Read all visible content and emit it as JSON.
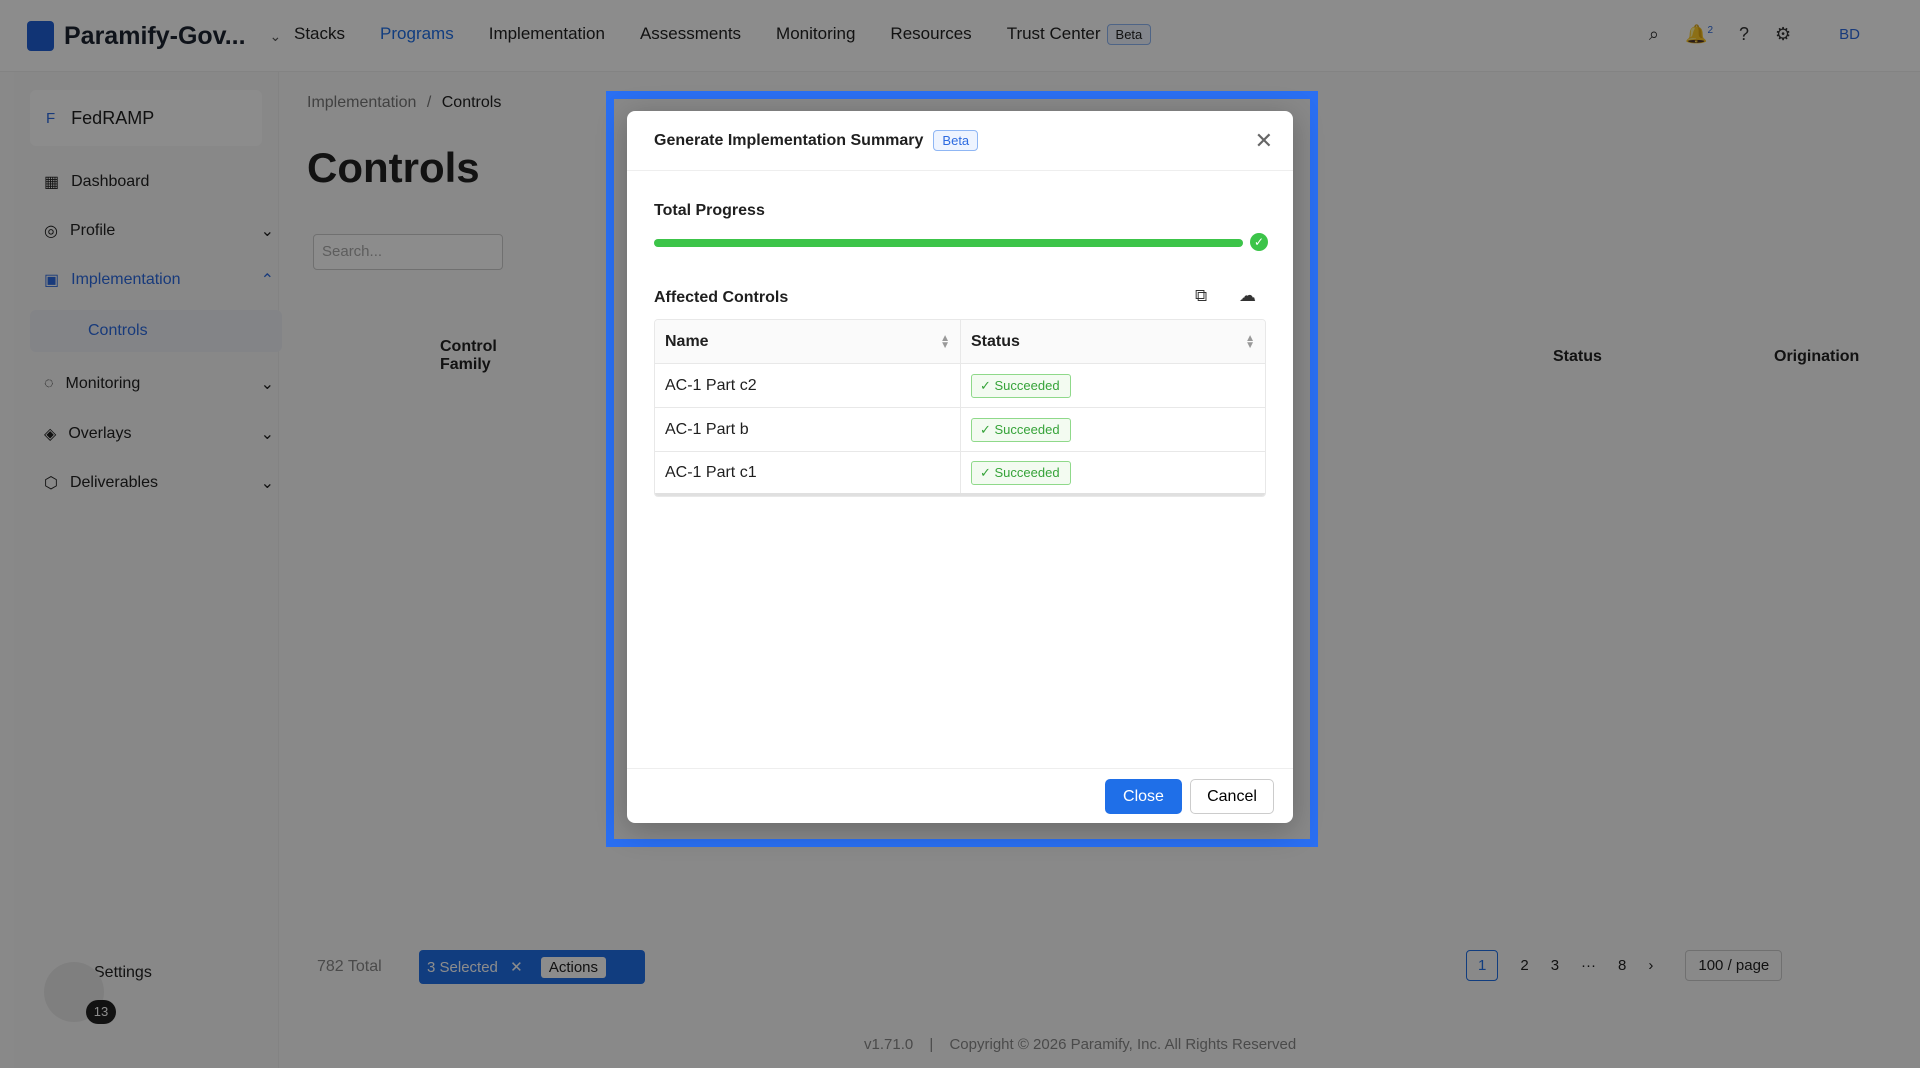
{
  "topbar": {
    "brand": "Paramify-Gov...",
    "nav": [
      {
        "label": "Stacks"
      },
      {
        "label": "Programs"
      },
      {
        "label": "Implementation"
      },
      {
        "label": "Assessments"
      },
      {
        "label": "Monitoring"
      },
      {
        "label": "Resources"
      },
      {
        "label": "Trust Center"
      }
    ],
    "beta": "Beta",
    "notif_count": "2",
    "avatar": "BD"
  },
  "sidebar": {
    "org": "FedRAMP",
    "org_initial": "F",
    "items": [
      {
        "label": "Dashboard"
      },
      {
        "label": "Profile"
      },
      {
        "label": "Implementation"
      },
      {
        "label": "Monitoring"
      },
      {
        "label": "Overlays"
      },
      {
        "label": "Deliverables"
      }
    ],
    "sub": "Controls",
    "settings": "Settings",
    "help_badge": "13"
  },
  "page": {
    "breadcrumb_parent": "Implementation",
    "breadcrumb_sep": "/",
    "breadcrumb_current": "Controls",
    "title": "Controls",
    "search_placeholder": "Search...",
    "total": "782 Total",
    "selected": "3 Selected",
    "actions": "Actions",
    "pages": [
      "1",
      "2",
      "3",
      "8"
    ],
    "per_page": "100 / page",
    "version": "v1.71.0",
    "copyright": "Copyright © 2026 Paramify, Inc. All Rights Reserved",
    "col_family": "Control Family",
    "col_status": "Status",
    "col_origination": "Origination"
  },
  "modal": {
    "title": "Generate Implementation Summary",
    "beta": "Beta",
    "progress_label": "Total Progress",
    "progress": 1.0,
    "affected_label": "Affected Controls",
    "col_name": "Name",
    "col_status": "Status",
    "rows": [
      {
        "name": "AC-1 Part c2",
        "status": "Succeeded"
      },
      {
        "name": "AC-1 Part b",
        "status": "Succeeded"
      },
      {
        "name": "AC-1 Part c1",
        "status": "Succeeded"
      }
    ],
    "close": "Close",
    "cancel": "Cancel"
  }
}
